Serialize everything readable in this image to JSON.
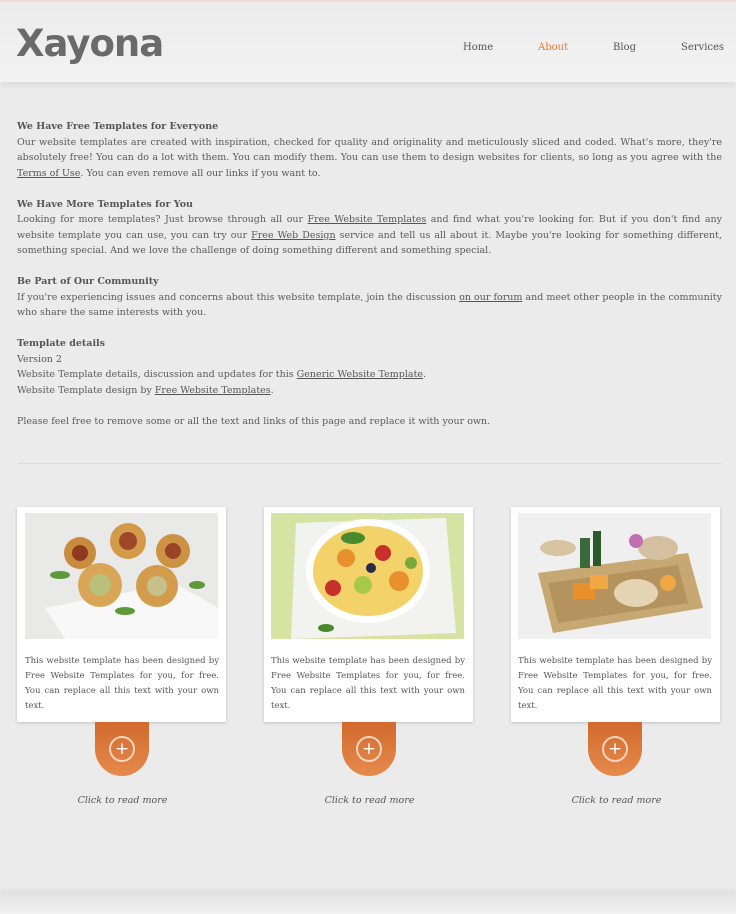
{
  "brand": {
    "logo": "Xayona"
  },
  "nav": [
    {
      "label": "Home",
      "active": false
    },
    {
      "label": "About",
      "active": true
    },
    {
      "label": "Blog",
      "active": false
    },
    {
      "label": "Services",
      "active": false
    }
  ],
  "content": {
    "s1": {
      "heading": "We Have Free Templates for Everyone",
      "text1": "Our website templates are created with inspiration, checked for quality and originality and meticulously sliced and coded. What's more, they're absolutely free! You can do a lot with them. You can modify them. You can use them to design websites for clients, so long as you agree with the ",
      "link1": "Terms of Use",
      "text2": ". You can even remove all our links if you want to."
    },
    "s2": {
      "heading": "We Have More Templates for You",
      "text1": "Looking for more templates? Just browse through all our ",
      "link1": "Free Website Templates",
      "text2": " and find what you're looking for. But if you don't find any website template you can use, you can try our ",
      "link2": "Free Web Design",
      "text3": " service and tell us all about it. Maybe you're looking for something different, something special. And we love the challenge of doing something different and something special."
    },
    "s3": {
      "heading": "Be Part of Our Community",
      "text1": "If you're experiencing issues and concerns about this website template, join the discussion ",
      "link1": "on our forum",
      "text2": " and meet other people in the community who share the same interests with you."
    },
    "s4": {
      "heading": "Template details",
      "version": "Version 2",
      "line1": "Website Template details, discussion and updates for this ",
      "link1": "Generic Website Template",
      "line1_end": ".",
      "line2": "Website Template design by ",
      "link2": "Free Website Templates",
      "line2_end": "."
    },
    "closing": "Please feel free to remove some or all the text and links of this page and replace it with your own."
  },
  "cards": [
    {
      "text": "This website template has been designed by Free Website Templates for you, for free. You can replace all this text with your own text.",
      "more": "Click to read more"
    },
    {
      "text": "This website template has been designed by Free Website Templates for you, for free. You can replace all this text with your own text.",
      "more": "Click to read more"
    },
    {
      "text": "This website template has been designed by Free Website Templates for you, for free. You can replace all this text with your own text.",
      "more": "Click to read more"
    }
  ],
  "icons": {
    "plus": "plus-circle-icon"
  },
  "colors": {
    "accent": "#e07b39",
    "tab": "#d9763a"
  }
}
